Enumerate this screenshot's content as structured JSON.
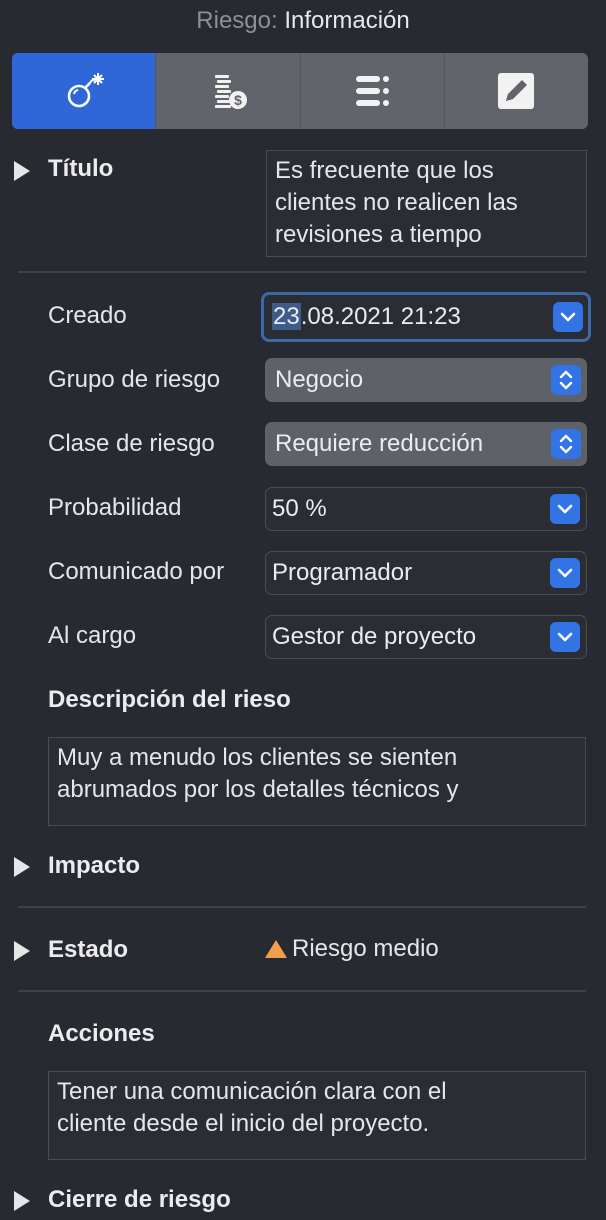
{
  "header": {
    "prefix": "Riesgo:",
    "title": "Información"
  },
  "tabs": [
    {
      "icon": "bomb-icon",
      "active": true
    },
    {
      "icon": "coins-dollar-icon",
      "active": false
    },
    {
      "icon": "list-icon",
      "active": false
    },
    {
      "icon": "pencil-icon",
      "active": false
    }
  ],
  "titulo": {
    "label": "Título",
    "value_lines": [
      "Es frecuente que los",
      "clientes no realicen las",
      "revisiones a tiempo"
    ]
  },
  "creado": {
    "label": "Creado",
    "value_selected": "23",
    "value_rest": ".08.2021 21:23"
  },
  "grupo": {
    "label": "Grupo de riesgo",
    "value": "Negocio"
  },
  "clase": {
    "label": "Clase de riesgo",
    "value": "Requiere reducción"
  },
  "probabilidad": {
    "label": "Probabilidad",
    "value": "50 %"
  },
  "comunicado": {
    "label": "Comunicado por",
    "value": "Programador"
  },
  "cargo": {
    "label": "Al cargo",
    "value": "Gestor de proyecto"
  },
  "descripcion": {
    "label": "Descripción del rieso",
    "value_lines": [
      "Muy a menudo los clientes se sienten",
      "abrumados por los detalles técnicos y"
    ]
  },
  "impacto": {
    "label": "Impacto"
  },
  "estado": {
    "label": "Estado",
    "value": "Riesgo medio",
    "warning_color": "#f0a04b"
  },
  "acciones": {
    "label": "Acciones",
    "value_lines": [
      "Tener una comunicación clara con el",
      "cliente desde el inicio del proyecto."
    ]
  },
  "cierre": {
    "label": "Cierre de riesgo"
  },
  "colors": {
    "accent": "#2f67d8",
    "button": "#3273e6",
    "background": "#282a31"
  }
}
